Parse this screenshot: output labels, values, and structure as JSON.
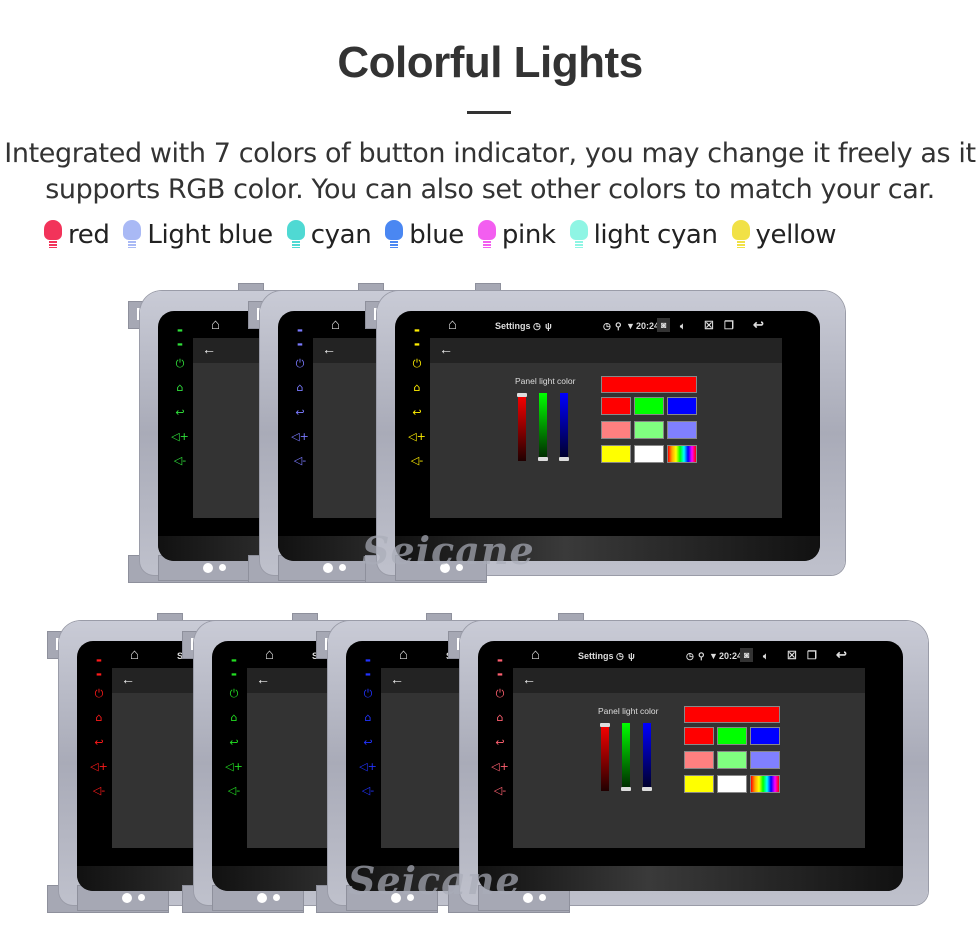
{
  "heading": "Colorful Lights",
  "description": "Integrated with 7 colors of button indicator, you may change it freely as it supports RGB color. You can also set other colors to match your car.",
  "legend": [
    {
      "label": "red",
      "color": "#f2335a"
    },
    {
      "label": "Light blue",
      "color": "#a9b9f5"
    },
    {
      "label": "cyan",
      "color": "#4fd9d3"
    },
    {
      "label": "blue",
      "color": "#4a87f2"
    },
    {
      "label": "pink",
      "color": "#f35ef0"
    },
    {
      "label": "light cyan",
      "color": "#8ff5e4"
    },
    {
      "label": "yellow",
      "color": "#f1e146"
    }
  ],
  "screen": {
    "title": "Settings",
    "time": "20:24",
    "panel_label": "Panel light color",
    "slider_values": {
      "red": 1.0,
      "green": 0.0,
      "blue": 0.0
    },
    "swatches": [
      "#ff0000",
      "#00ff00",
      "#0000ff",
      "#ff8080",
      "#80ff80",
      "#8080ff",
      "#ffff00",
      "#ffffff",
      "rainbow"
    ],
    "selected_color": "#ff0000"
  },
  "units_top_button_colors": [
    "#2fe03a",
    "#7a7aff",
    "#ffee00"
  ],
  "units_bottom_button_colors": [
    "#ff1a1a",
    "#22dd22",
    "#2233ff",
    "#ff6070"
  ],
  "watermark": "Seicane"
}
